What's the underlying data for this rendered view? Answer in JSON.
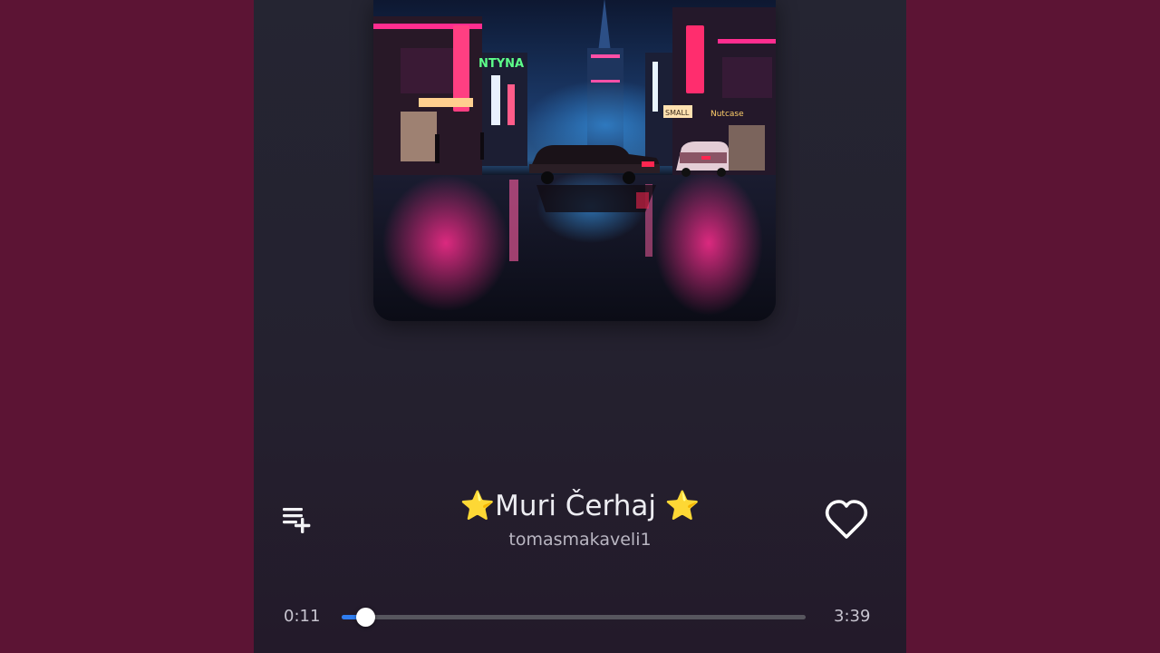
{
  "player": {
    "track_title": "⭐Muri Čerhaj ⭐",
    "artist": "tomasmakaveli1",
    "elapsed": "0:11",
    "duration": "3:39",
    "progress_fraction": 0.05
  },
  "album_art": {
    "sign_left": "NTYNA",
    "sign_center": "SMALL",
    "sign_right": "Nutcase"
  },
  "icons": {
    "queue": "queue-add-icon",
    "like": "heart-outline-icon"
  },
  "colors": {
    "page_background": "#5c1434",
    "player_background": "#252532",
    "progress_accent": "#2f7df0",
    "progress_track": "#57565e"
  }
}
